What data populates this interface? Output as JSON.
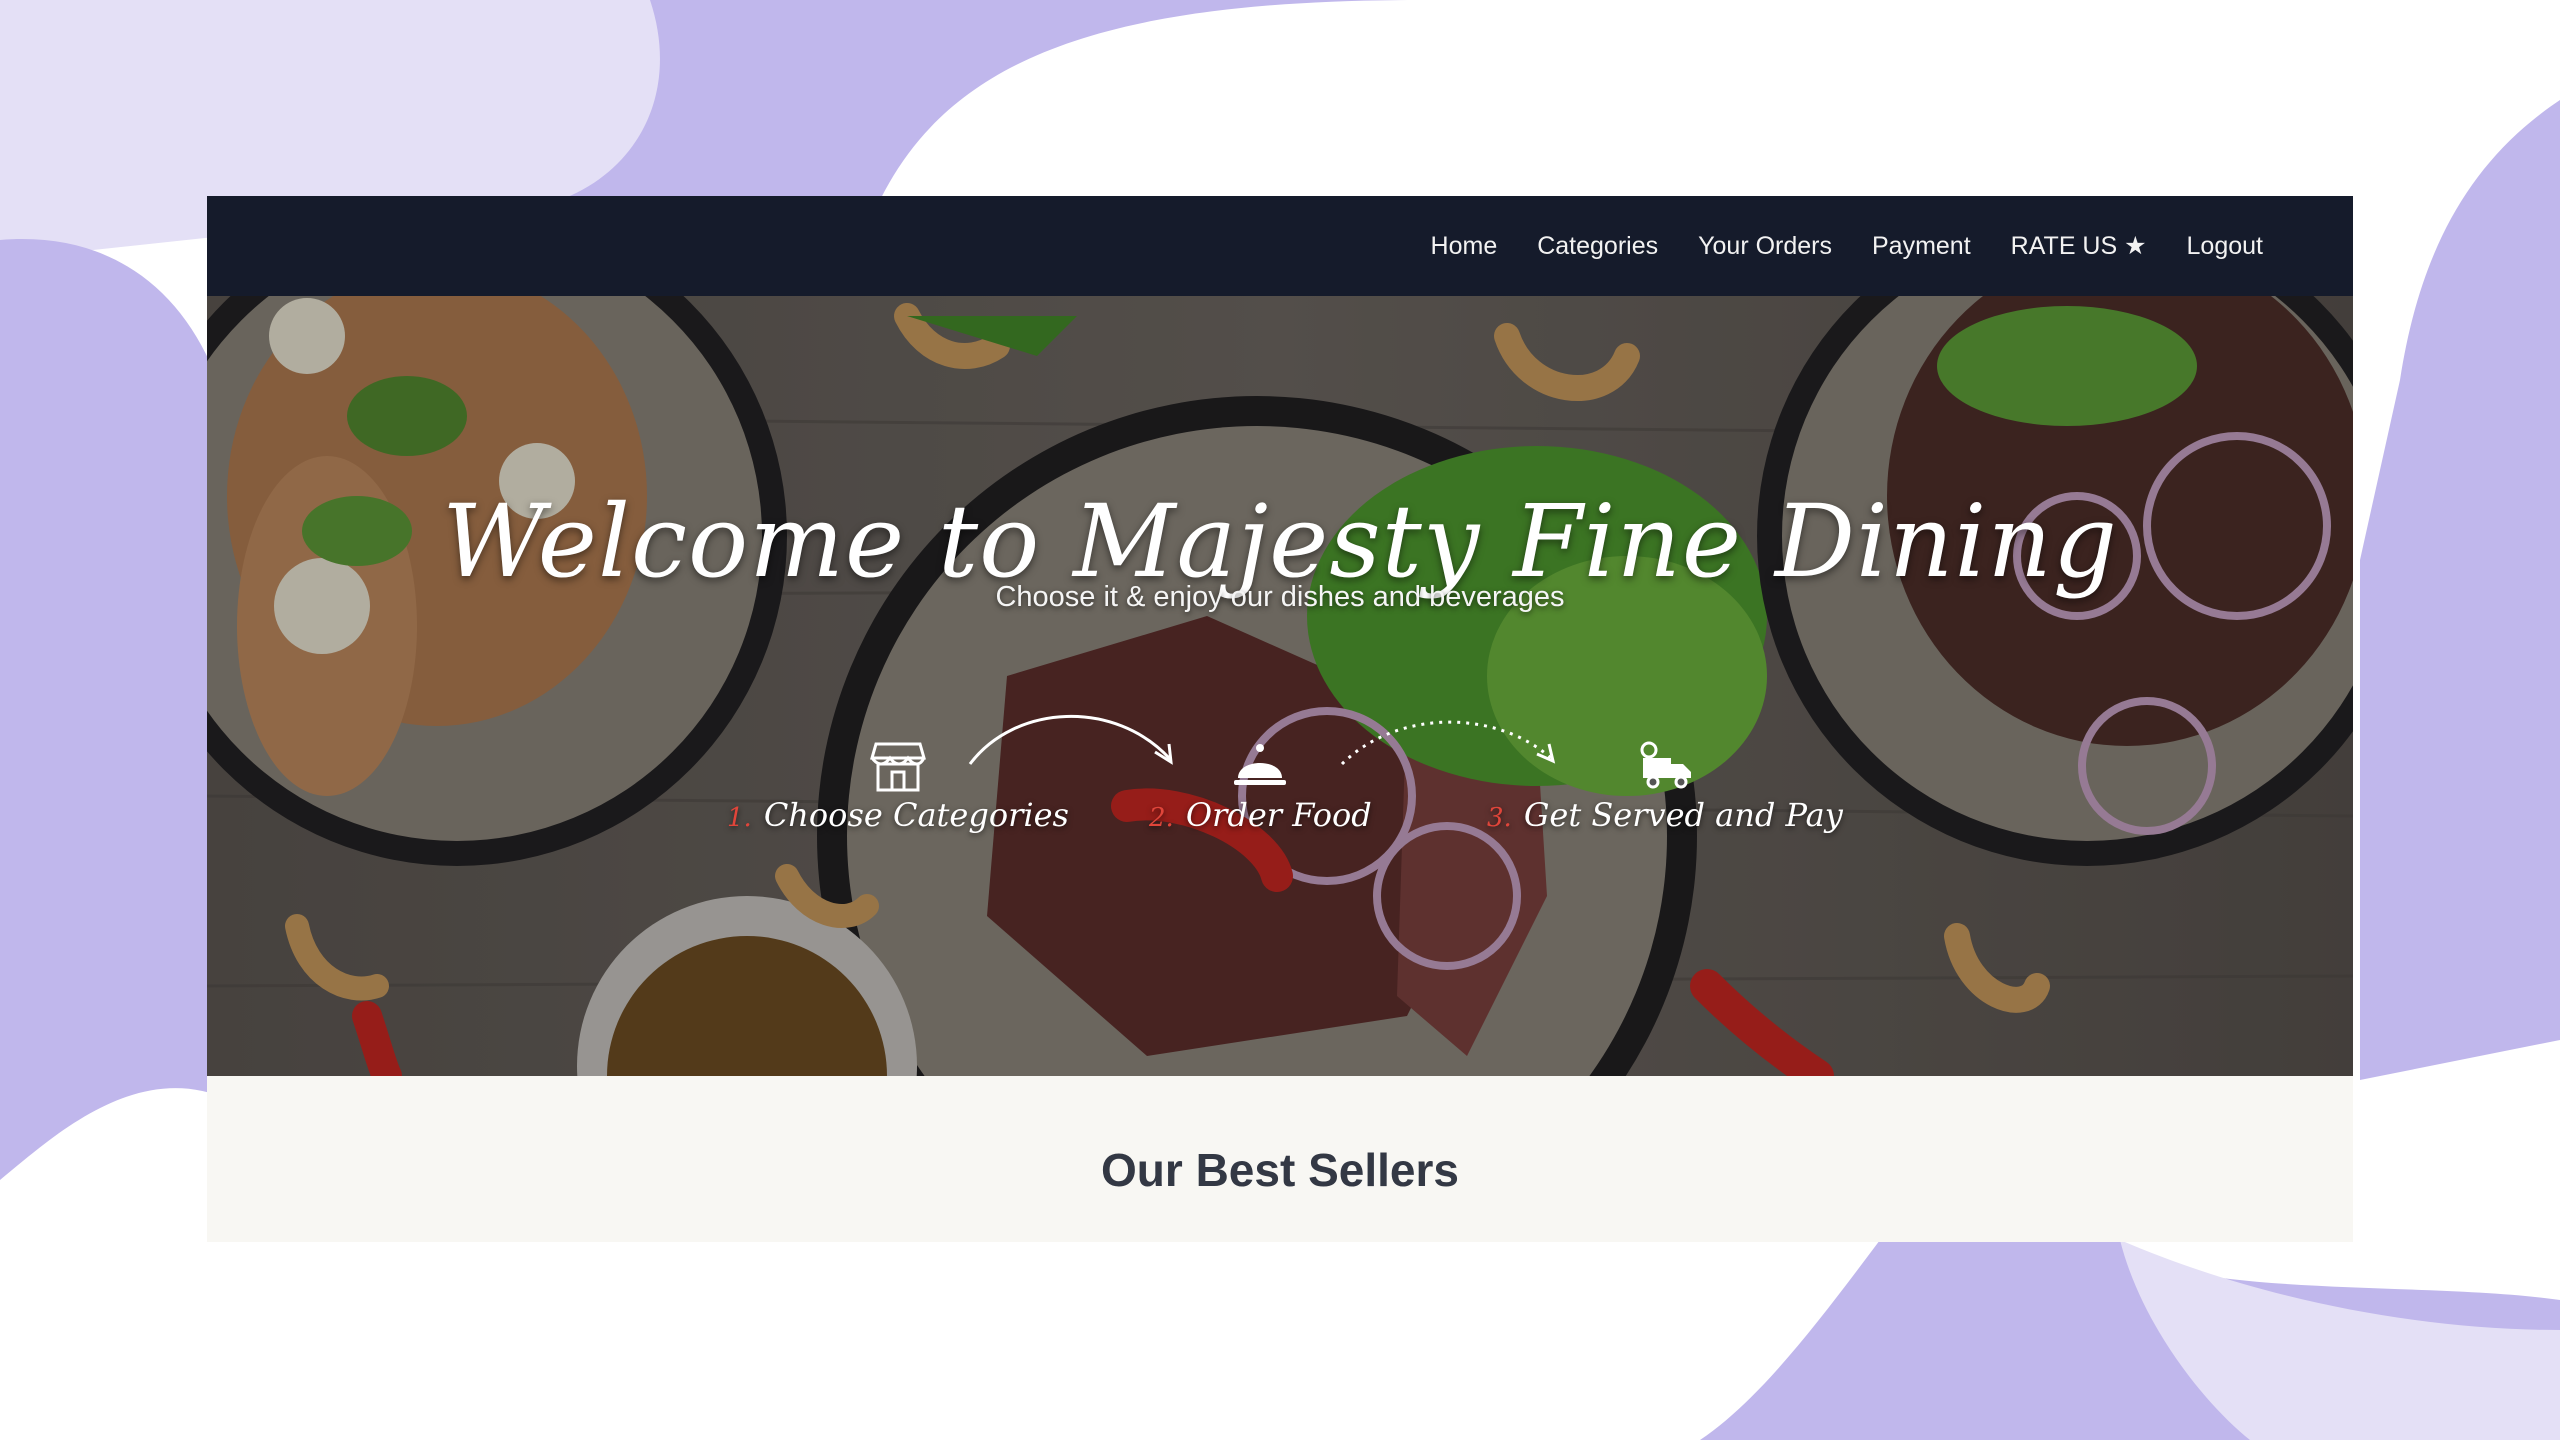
{
  "nav": {
    "items": [
      {
        "label": "Home"
      },
      {
        "label": "Categories"
      },
      {
        "label": "Your Orders"
      },
      {
        "label": "Payment"
      },
      {
        "label": "RATE US ★"
      },
      {
        "label": "Logout"
      }
    ]
  },
  "hero": {
    "title": "Welcome to Majesty Fine Dining",
    "subtitle": "Choose it & enjoy our dishes and beverages",
    "steps": [
      {
        "number": "1.",
        "label": "Choose Categories",
        "icon": "store-icon"
      },
      {
        "number": "2.",
        "label": "Order Food",
        "icon": "cloche-icon"
      },
      {
        "number": "3.",
        "label": "Get Served and Pay",
        "icon": "delivery-truck-icon"
      }
    ]
  },
  "section": {
    "title": "Our Best Sellers"
  },
  "colors": {
    "navbar": "#151b2b",
    "accent_purple": "#c0b7ec",
    "light_purple": "#e4e0f6",
    "step_number": "#e0453a",
    "page_bg": "#f8f7f3"
  }
}
